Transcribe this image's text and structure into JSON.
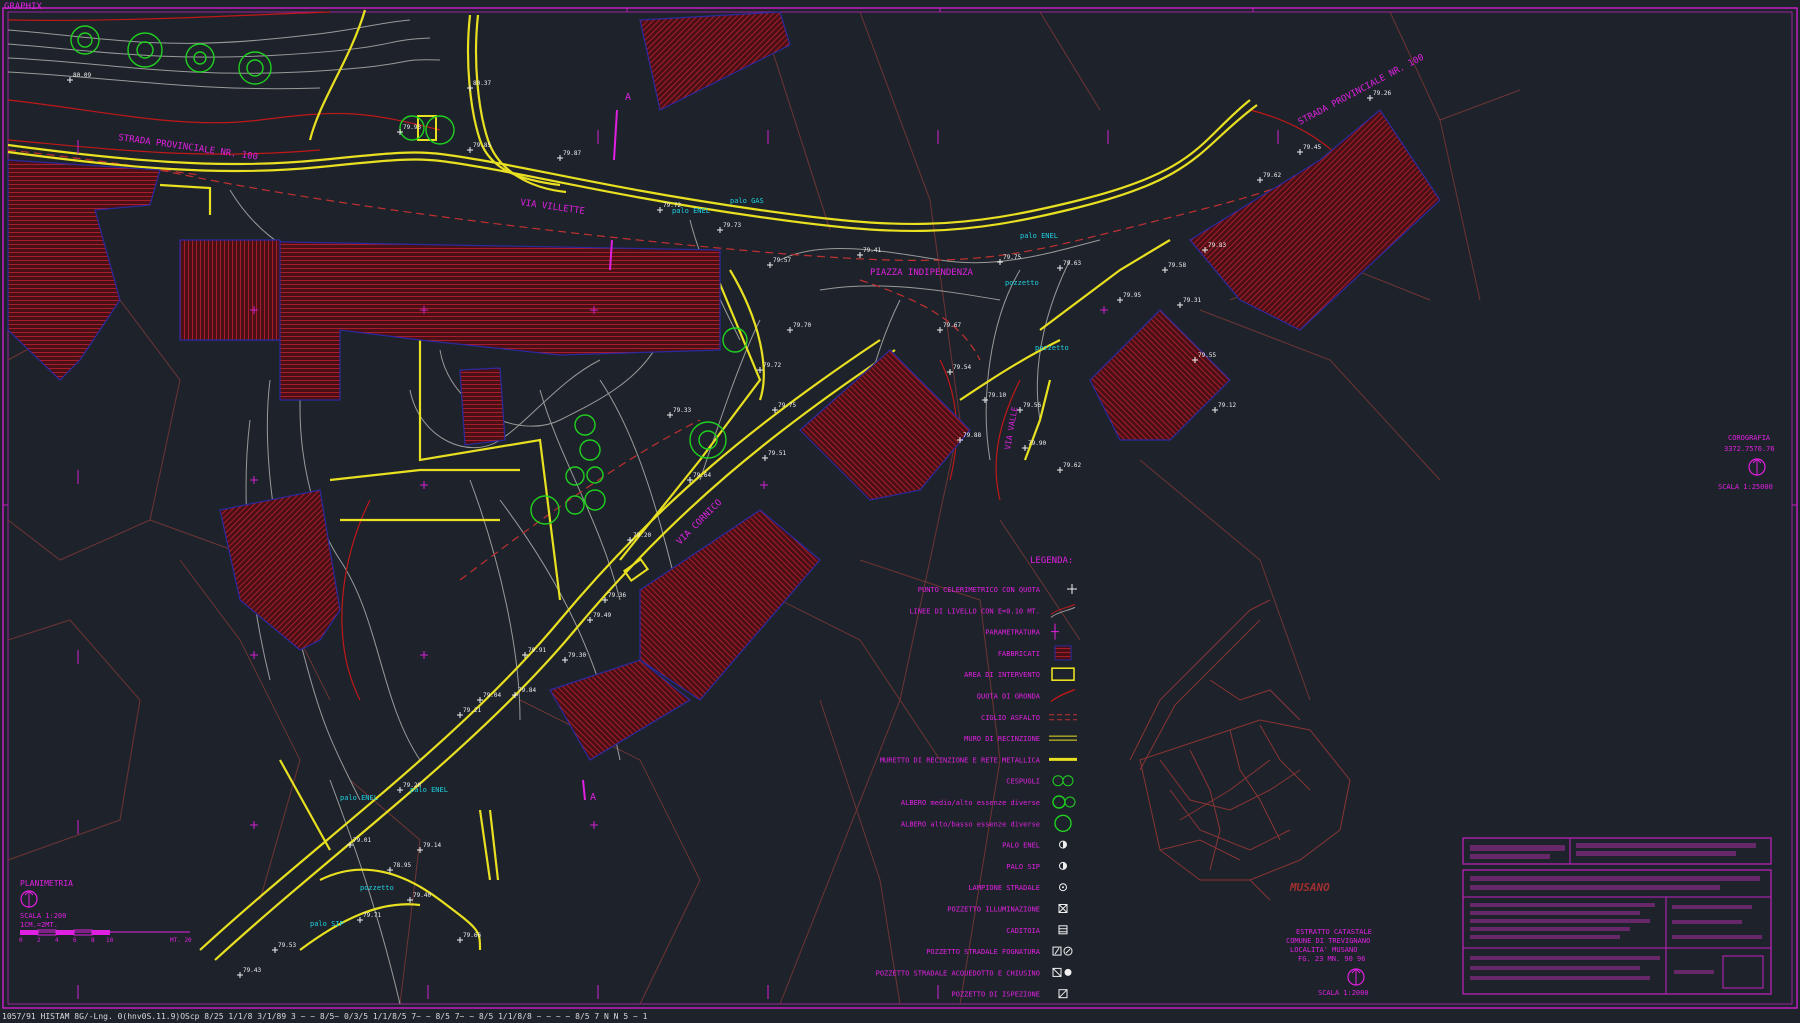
{
  "app": {
    "label": "GRAPHIX"
  },
  "colors": {
    "background": "#1e232b",
    "frame": "#c020c0",
    "contour": "#a8a8a8",
    "contour_index": "#d02020",
    "road": "#e8e020",
    "building_fill": "#5a1218",
    "building_hatch": "#c02030",
    "building_edge": "#2a2aa0",
    "cadastral": "#7a3a3a",
    "tree": "#20d020",
    "label_magenta": "#e020e0",
    "label_white": "#f0f0f0",
    "label_cyan": "#20d0e0"
  },
  "streets": [
    {
      "name": "STRADA PROVINCIALE NR. 100"
    },
    {
      "name": "STRADA PROVINCIALE NR. 100"
    },
    {
      "name": "VIA VILLETTE"
    },
    {
      "name": "PIAZZA INDIPENDENZA"
    },
    {
      "name": "VIA CORNICO"
    },
    {
      "name": "VIA VALLE"
    }
  ],
  "section_markers": [
    {
      "label": "A"
    },
    {
      "label": "A"
    }
  ],
  "spot_heights": [
    "80.09",
    "80.37",
    "79.93",
    "79.85",
    "79.87",
    "79.72",
    "79.73",
    "79.57",
    "79.41",
    "79.75",
    "79.63",
    "79.58",
    "79.31",
    "79.55",
    "79.12",
    "79.26",
    "79.45",
    "79.62",
    "79.83",
    "79.95",
    "79.67",
    "79.54",
    "79.10",
    "79.88",
    "79.56",
    "79.90",
    "79.62",
    "79.70",
    "79.72",
    "79.75",
    "79.51",
    "79.33",
    "79.64",
    "79.20",
    "79.36",
    "79.49",
    "79.30",
    "79.91",
    "79.84",
    "79.04",
    "79.21",
    "79.28",
    "79.14",
    "79.01",
    "78.95",
    "79.40",
    "79.66",
    "79.71",
    "79.53",
    "79.43"
  ],
  "utility_labels": [
    "palo ENEL",
    "palo GAS",
    "palo ENEL",
    "pozzetto",
    "pozzetto",
    "palo ENEL",
    "palo ENEL",
    "pozzetto",
    "palo SIP"
  ],
  "legend": {
    "title": "LEGENDA:",
    "items": [
      {
        "label": "PUNTO CELERIMETRICO CON QUOTA",
        "symbol": "point-height"
      },
      {
        "label": "LINEE DI LIVELLO CON E=0.10 MT.",
        "symbol": "contour-lines"
      },
      {
        "label": "PARAMETRATURA",
        "symbol": "gridmark"
      },
      {
        "label": "FABBRICATI",
        "symbol": "building-hatch"
      },
      {
        "label": "AREA DI INTERVENTO",
        "symbol": "yellow-box"
      },
      {
        "label": "QUOTA DI GRONDA",
        "symbol": "red-curve"
      },
      {
        "label": "CIGLIO ASFALTO",
        "symbol": "dashed-red"
      },
      {
        "label": "MURO DI RECINZIONE",
        "symbol": "double-yellow"
      },
      {
        "label": "MURETTO DI RECINZIONE E RETE METALLICA",
        "symbol": "thick-yellow"
      },
      {
        "label": "CESPUGLI",
        "symbol": "shrub"
      },
      {
        "label": "ALBERO medio/alto essenze diverse",
        "symbol": "tree"
      },
      {
        "label": "ALBERO alto/basso essenze diverse",
        "symbol": "tree-small"
      },
      {
        "label": "PALO ENEL",
        "symbol": "circle-half"
      },
      {
        "label": "PALO SIP",
        "symbol": "circle-half"
      },
      {
        "label": "LAMPIONE STRADALE",
        "symbol": "circle-dot"
      },
      {
        "label": "POZZETTO ILLUMINAZIONE",
        "symbol": "box-x"
      },
      {
        "label": "CADITOIA",
        "symbol": "box-grid"
      },
      {
        "label": "POZZETTO STRADALE FOGNATURA",
        "symbol": "box-f"
      },
      {
        "label": "POZZETTO STRADALE ACQUEDOTTO E CHIUSINO",
        "symbol": "box-a"
      },
      {
        "label": "POZZETTO DI ISPEZIONE",
        "symbol": "box-slash"
      }
    ]
  },
  "planimetria": {
    "title": "PLANIMETRIA",
    "scale": "SCALA 1:200",
    "note": "1CM.=2MT.",
    "ticks": [
      "0",
      "2",
      "4",
      "6",
      "8",
      "10"
    ],
    "unit": "MT. 20"
  },
  "corografia": {
    "title": "COROGRAFIA",
    "code": "3372.7576.76",
    "scale": "SCALA 1:25000"
  },
  "estratto": {
    "lines": [
      "ESTRATTO CATASTALE",
      "COMUNE DI TREVIGNANO",
      "LOCALITA' MUSANO",
      "FG. 23   MN. 90 96"
    ],
    "scale": "SCALA 1:2000",
    "locality": "MUSANO"
  },
  "status": {
    "text": "1057/91  HISTAM 8G/-Lng. 0(hnv0S.11.9)OScp 8/25 1/1/8 3/1/89 3 ~  ~  8/5~ 0/3/5 1/1/8/5 7~  ~  8/5 7~  ~  8/5 1/1/8/8 ~  ~  ~  ~  8/5 7  N  N  5 ~  1"
  }
}
